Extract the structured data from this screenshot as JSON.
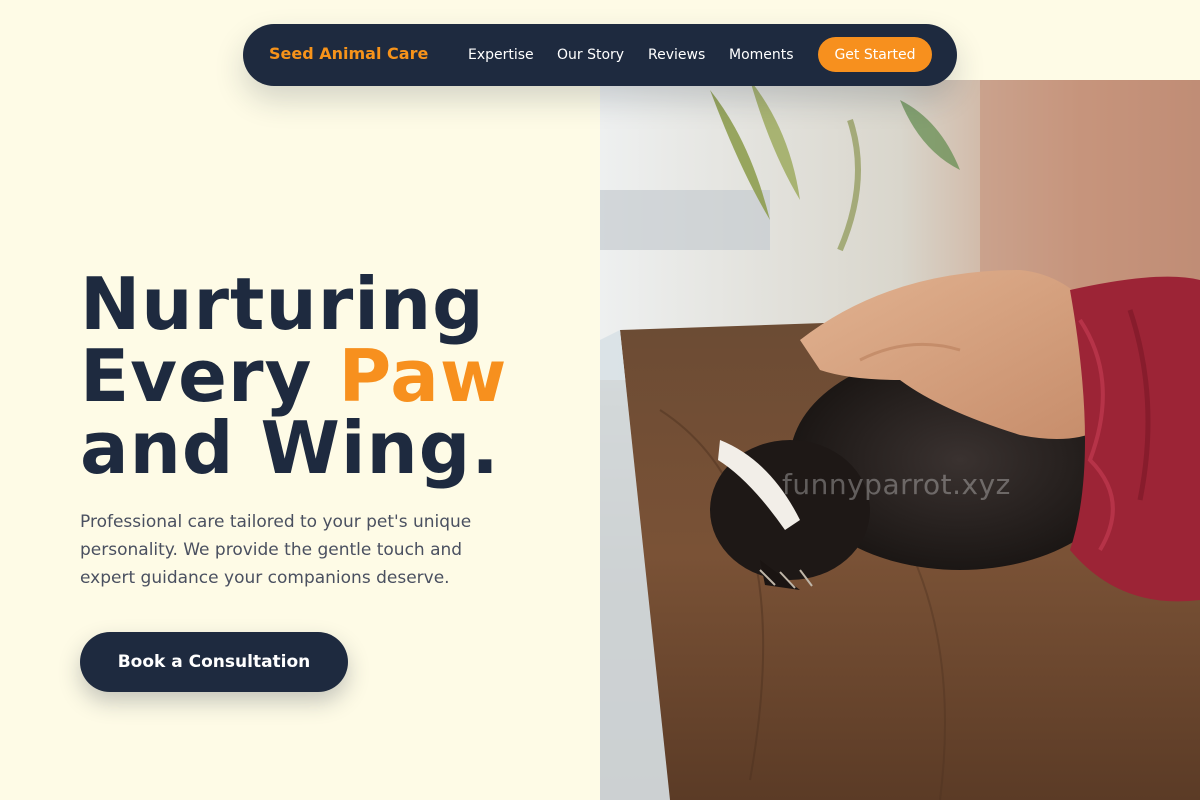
{
  "nav": {
    "brand": "Seed Animal Care",
    "links": [
      {
        "label": "Expertise"
      },
      {
        "label": "Our Story"
      },
      {
        "label": "Reviews"
      },
      {
        "label": "Moments"
      }
    ],
    "cta_label": "Get Started"
  },
  "hero": {
    "headline_line1": "Nurturing",
    "headline_line2_prefix": "Every ",
    "headline_line2_accent": "Paw",
    "headline_line3": "and Wing.",
    "subtext": "Professional care tailored to your pet's unique personality. We provide the gentle touch and expert guidance your companions deserve.",
    "button_label": "Book a Consultation",
    "image_watermark": "funnyparrot.xyz"
  },
  "colors": {
    "background": "#fefbe6",
    "navy": "#1e2a3f",
    "accent": "#f7901e"
  }
}
